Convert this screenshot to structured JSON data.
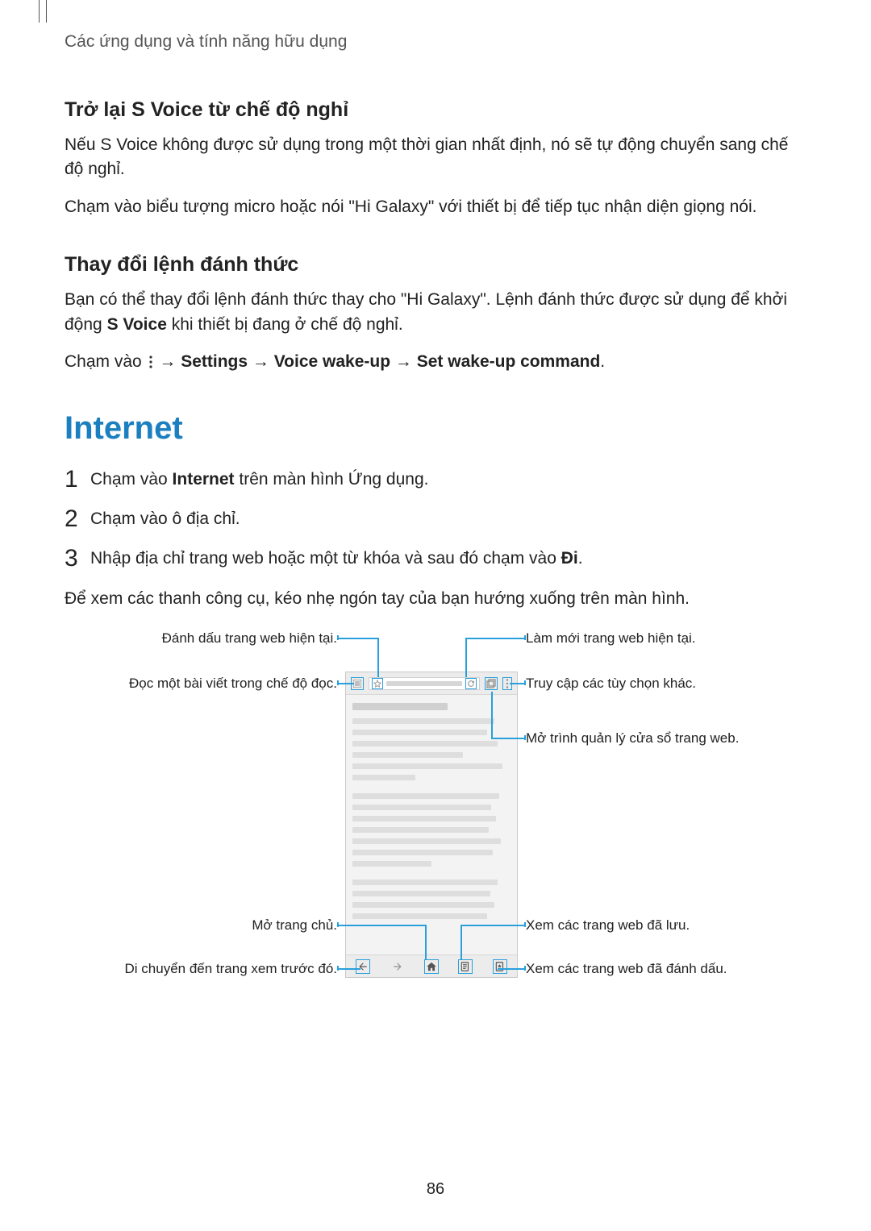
{
  "header": {
    "running": "Các ứng dụng và tính năng hữu dụng"
  },
  "svoice": {
    "resume_heading": "Trở lại S Voice từ chế độ nghỉ",
    "resume_p1": "Nếu S Voice không được sử dụng trong một thời gian nhất định, nó sẽ tự động chuyển sang chế độ nghỉ.",
    "resume_p2": "Chạm vào biểu tượng micro hoặc nói \"Hi Galaxy\" với thiết bị để tiếp tục nhận diện giọng nói.",
    "wake_heading": "Thay đổi lệnh đánh thức",
    "wake_p1_a": "Bạn có thể thay đổi lệnh đánh thức thay cho \"Hi Galaxy\". Lệnh đánh thức được sử dụng để khởi động ",
    "wake_p1_b": "S Voice",
    "wake_p1_c": " khi thiết bị đang ở chế độ nghỉ.",
    "wake_path_prefix": "Chạm vào ",
    "wake_path_arrow1": " → ",
    "wake_path_settings": "Settings",
    "wake_path_arrow2": " → ",
    "wake_path_voice": "Voice wake-up",
    "wake_path_arrow3": " → ",
    "wake_path_set": "Set wake-up command",
    "wake_path_period": "."
  },
  "internet": {
    "title": "Internet",
    "step1_a": "Chạm vào ",
    "step1_b": "Internet",
    "step1_c": " trên màn hình Ứng dụng.",
    "step2": "Chạm vào ô địa chỉ.",
    "step3_a": "Nhập địa chỉ trang web hoặc một từ khóa và sau đó chạm vào ",
    "step3_b": "Đi",
    "step3_c": ".",
    "after_steps": "Để xem các thanh công cụ, kéo nhẹ ngón tay của bạn hướng xuống trên màn hình."
  },
  "callouts": {
    "bookmark_current": "Đánh dấu trang web hiện tại.",
    "reader_mode": "Đọc một bài viết trong chế độ đọc.",
    "open_home": "Mở trang chủ.",
    "go_back": "Di chuyển đến trang xem trước đó.",
    "refresh": "Làm mới trang web hiện tại.",
    "more_options": "Truy cập các tùy chọn khác.",
    "window_manager": "Mở trình quản lý cửa sổ trang web.",
    "saved_pages": "Xem các trang web đã lưu.",
    "bookmarks": "Xem các trang web đã đánh dấu."
  },
  "icons": {
    "more": "more-options-icon",
    "reader": "reader-icon",
    "star": "bookmark-star-icon",
    "refresh": "refresh-icon",
    "windows": "window-manager-icon",
    "back": "back-arrow-icon",
    "forward": "forward-arrow-icon",
    "home": "home-icon",
    "saved": "saved-pages-icon",
    "bookmarks": "bookmarks-list-icon"
  },
  "page_number": "86"
}
